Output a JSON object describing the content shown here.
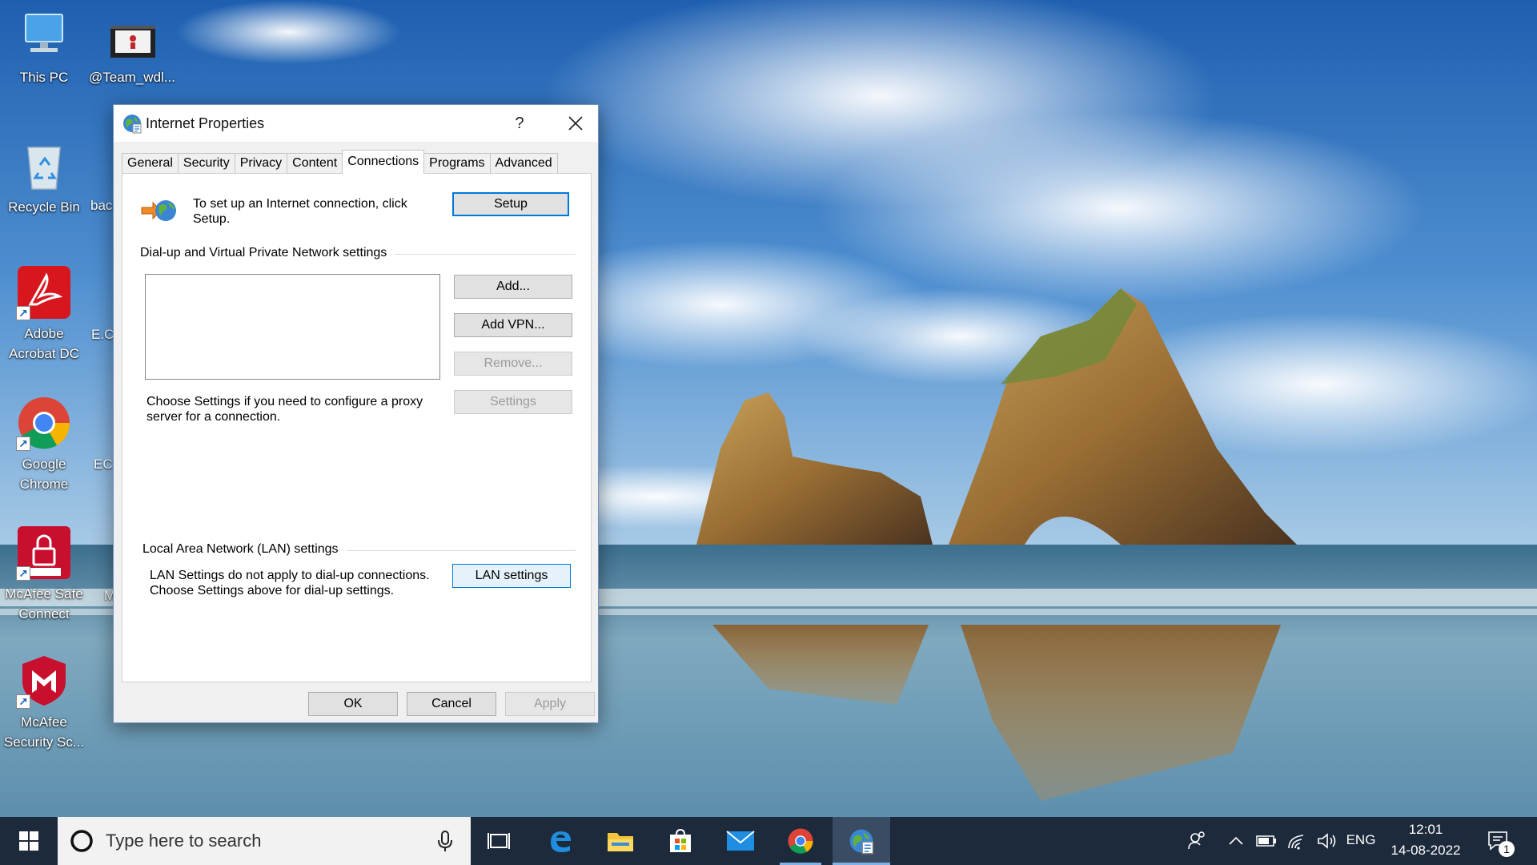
{
  "desktop": {
    "icons": [
      {
        "label": "This PC"
      },
      {
        "label": "@Team_wdl..."
      },
      {
        "label": "Recycle Bin"
      },
      {
        "label": "Adobe Acrobat DC"
      },
      {
        "label": "Google Chrome"
      },
      {
        "label": "McAfee Safe Connect"
      },
      {
        "label": "McAfee Security Sc..."
      }
    ],
    "partial_labels": [
      "bac",
      "E.C",
      "EC",
      "M"
    ]
  },
  "dialog": {
    "title": "Internet Properties",
    "help_label": "?",
    "tabs": [
      {
        "label": "General"
      },
      {
        "label": "Security"
      },
      {
        "label": "Privacy"
      },
      {
        "label": "Content"
      },
      {
        "label": "Connections"
      },
      {
        "label": "Programs"
      },
      {
        "label": "Advanced"
      }
    ],
    "active_tab": "Connections",
    "setup": {
      "text": "To set up an Internet connection, click Setup.",
      "button": "Setup"
    },
    "dialup": {
      "group_label": "Dial-up and Virtual Private Network settings",
      "add_button": "Add...",
      "add_vpn_button": "Add VPN...",
      "remove_button": "Remove...",
      "settings_button": "Settings",
      "proxy_text": "Choose Settings if you need to configure a proxy server for a connection."
    },
    "lan": {
      "group_label": "Local Area Network (LAN) settings",
      "text": "LAN Settings do not apply to dial-up connections. Choose Settings above for dial-up settings.",
      "button": "LAN settings"
    },
    "footer": {
      "ok": "OK",
      "cancel": "Cancel",
      "apply": "Apply"
    }
  },
  "taskbar": {
    "search_placeholder": "Type here to search",
    "language": "ENG",
    "time": "12:01",
    "date": "14-08-2022",
    "notification_count": "1",
    "pinned": [
      "task-view",
      "edge",
      "file-explorer",
      "microsoft-store",
      "mail",
      "chrome",
      "internet-properties"
    ]
  }
}
